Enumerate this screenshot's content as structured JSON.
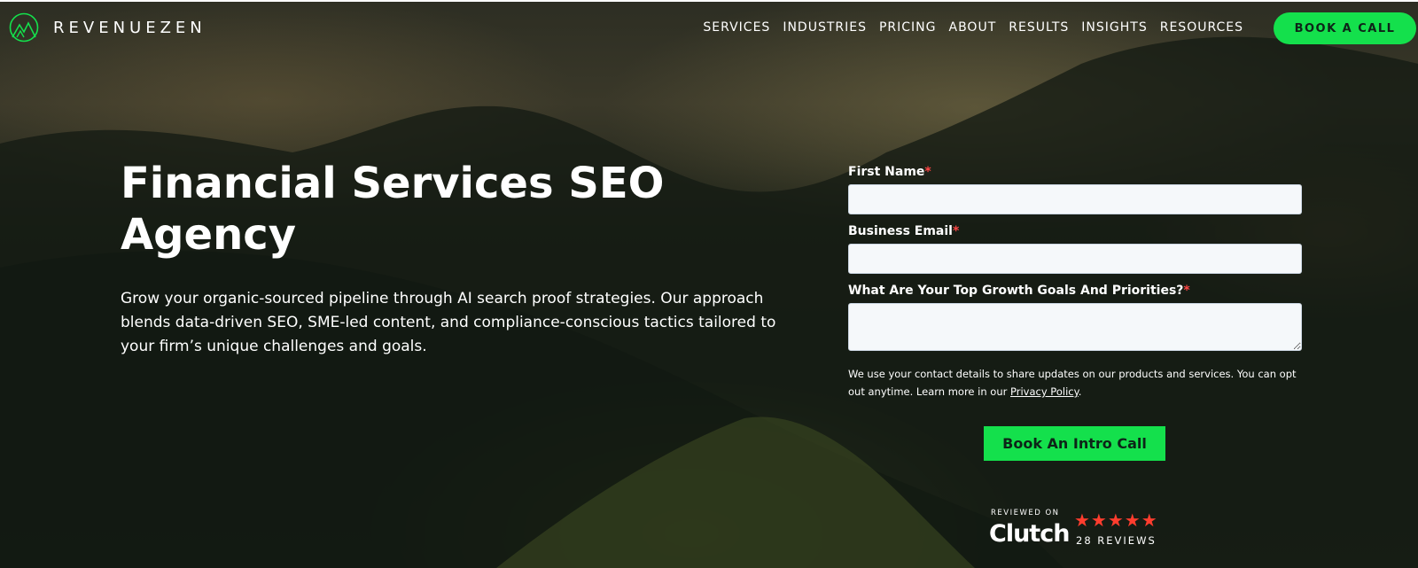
{
  "header": {
    "logo_text": "REVENUEZEN",
    "nav": [
      "SERVICES",
      "INDUSTRIES",
      "PRICING",
      "ABOUT",
      "RESULTS",
      "INSIGHTS",
      "RESOURCES"
    ],
    "cta_label": "BOOK A CALL"
  },
  "hero": {
    "title": "Financial Services SEO Agency",
    "subtitle": "Grow your organic-sourced pipeline through AI search proof strategies. Our approach blends data-driven SEO, SME-led content, and compliance-conscious tactics tailored to your firm’s unique challenges and goals."
  },
  "form": {
    "first_name_label": "First Name",
    "email_label": "Business Email",
    "goals_label": "What Are Your Top Growth Goals And Priorities?",
    "required_mark": "*",
    "consent_text": "We use your contact details to share updates on our products and services. You can opt out anytime. Learn more in our ",
    "privacy_link": "Privacy Policy",
    "consent_end": ".",
    "submit_label": "Book An Intro Call"
  },
  "clutch": {
    "reviewed_on": "REVIEWED ON",
    "brand": "Clutch",
    "stars": "★★★★★",
    "reviews": "28 REVIEWS"
  },
  "colors": {
    "accent": "#14e04c",
    "required": "#ff4545",
    "star": "#ff3d2e"
  }
}
